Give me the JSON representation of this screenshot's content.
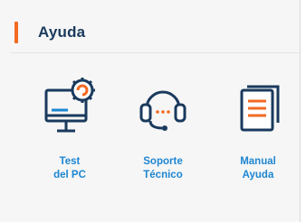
{
  "panel": {
    "title": "Ayuda",
    "accent_color": "#f26a21",
    "title_color": "#1a3a5d",
    "link_color": "#1d86d1"
  },
  "tiles": [
    {
      "icon": "monitor-gear-icon",
      "label": "Test\ndel PC"
    },
    {
      "icon": "headset-icon",
      "label": "Soporte\nTécnico"
    },
    {
      "icon": "document-manual-icon",
      "label": "Manual\nAyuda"
    }
  ]
}
